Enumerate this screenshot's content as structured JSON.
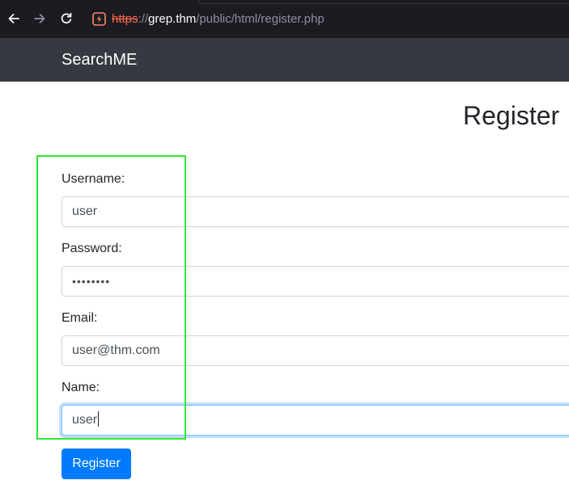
{
  "browser": {
    "url_scheme": "https",
    "url_separator": "://",
    "url_host": "grep.thm",
    "url_path": "/public/html/register.php",
    "icons": {
      "back": "back-arrow-icon",
      "forward": "forward-arrow-icon",
      "reload": "reload-icon",
      "site": "insecure-connection-icon"
    },
    "colors": {
      "background": "#1c1b22",
      "insecure_scheme": "#ff6a4d",
      "site_icon": "#ff8a65"
    }
  },
  "navbar": {
    "brand": "SearchME",
    "background": "#343a40"
  },
  "page": {
    "title": "Register"
  },
  "form": {
    "username": {
      "label": "Username:",
      "value": "user"
    },
    "password": {
      "label": "Password:",
      "value": "••••••••"
    },
    "email": {
      "label": "Email:",
      "value": "user@thm.com"
    },
    "name": {
      "label": "Name:",
      "value": "user"
    },
    "submit_label": "Register",
    "accent_color": "#007bff",
    "highlight_color": "#33e633"
  }
}
